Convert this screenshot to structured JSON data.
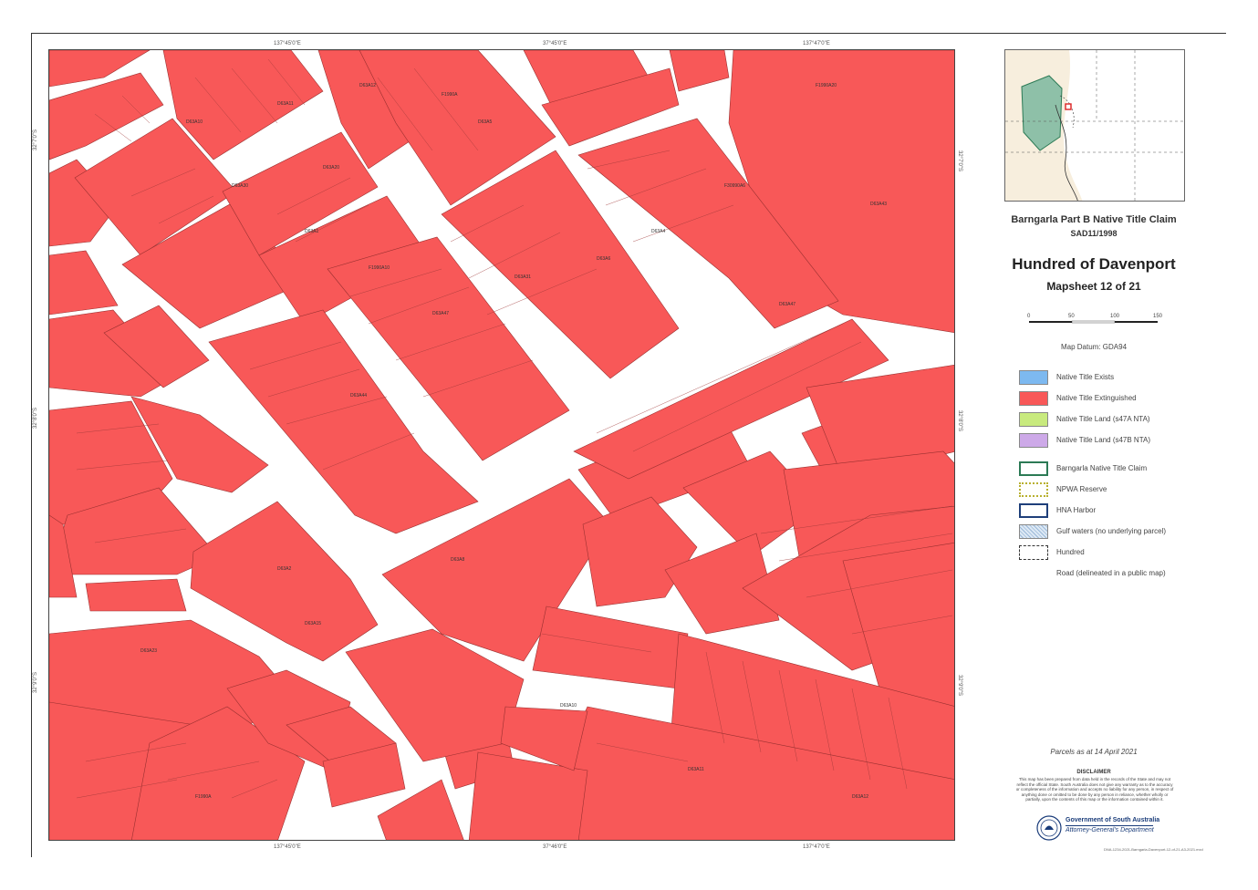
{
  "map": {
    "coords_top": [
      "137°45'0\"E",
      "37°45'0\"E",
      "137°47'0\"E"
    ],
    "coords_bottom": [
      "137°45'0\"E",
      "37°46'0\"E",
      "137°47'0\"E"
    ],
    "coords_left": [
      "32°7'0\"S",
      "32°8'0\"S",
      "32°9'0\"S"
    ],
    "coords_right": [
      "32°7'0\"S",
      "32°8'0\"S",
      "32°9'0\"S"
    ],
    "parcel_labels": [
      "D63A10",
      "D63A11",
      "D63A12",
      "F1990A",
      "D63A5",
      "D63A30",
      "D63A20",
      "D63A1",
      "F1990A10",
      "D63A47",
      "D63A31",
      "D63A6",
      "D63A4",
      "F30990A6",
      "F1990A20",
      "D63A43",
      "D63A47",
      "D63A44",
      "D63A2",
      "D63A8",
      "D63A15",
      "D63A23"
    ],
    "colors": {
      "extinguished": "#f85858",
      "road": "#ffffff",
      "parcel_line": "#7a2a2a"
    }
  },
  "titles": {
    "claim": "Barngarla Part B Native Title Claim",
    "sad": "SAD11/1998",
    "hundred": "Hundred of Davenport",
    "mapsheet": "Mapsheet 12 of 21"
  },
  "scale": {
    "labels": [
      "0",
      "50",
      "100",
      "150"
    ]
  },
  "datum": "Map Datum: GDA94",
  "legend": [
    {
      "label": "Native Title Exists",
      "color": "#7db9f0"
    },
    {
      "label": "Native Title Extinguished",
      "color": "#f85858"
    },
    {
      "label": "Native Title Land (s47A NTA)",
      "color": "#c8ea7e"
    },
    {
      "label": "Native Title Land (s47B NTA)",
      "color": "#cda9e8"
    },
    {
      "label": "Barngarla Native Title Claim",
      "color": "#2c7a55"
    },
    {
      "label": "NPWA Reserve",
      "color": "#b8b030"
    },
    {
      "label": "HNA Harbor",
      "color": "#1f3f7a"
    },
    {
      "label": "Gulf waters (no underlying parcel)",
      "color": "#9ab8d8"
    },
    {
      "label": "Hundred",
      "color": "#333333"
    },
    {
      "label": "Road (delineated in a public map)",
      "color": "#ffffff"
    }
  ],
  "parcels_date": "Parcels as at 14 April 2021",
  "disclaimer": {
    "title": "DISCLAIMER",
    "text": "This map has been prepared from data held in the records of the State and may not reflect the official State. South Australia does not give any warranty as to the accuracy or completeness of the information and accepts no liability for any person, in respect of anything done or omitted to be done by any person in reliance, whether wholly or partially, upon the contents of this map or the information contained within it."
  },
  "organisation": {
    "government": "Government of South Australia",
    "department": "Attorney-General's Department"
  },
  "file_ref": "DNA-1234-2021-Barngarla-Davenport-12-of-21-A3-2021.mxd"
}
